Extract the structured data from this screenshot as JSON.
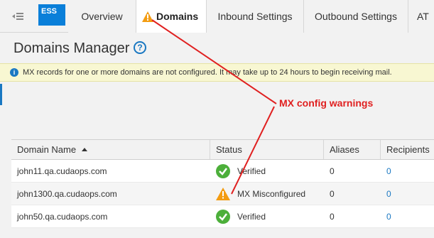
{
  "app": {
    "logo": "ESS"
  },
  "tabs": [
    {
      "label": "Overview",
      "active": false,
      "warning": false
    },
    {
      "label": "Domains",
      "active": true,
      "warning": true
    },
    {
      "label": "Inbound Settings",
      "active": false,
      "warning": false
    },
    {
      "label": "Outbound Settings",
      "active": false,
      "warning": false
    },
    {
      "label": "AT",
      "active": false,
      "warning": false
    }
  ],
  "page": {
    "title": "Domains Manager",
    "help": "?"
  },
  "banner": {
    "icon": "i",
    "text": "MX records for one or more domains are not configured. It may take up to 24 hours to begin receiving mail."
  },
  "annotation": {
    "text": "MX config warnings",
    "color": "#e02020"
  },
  "table": {
    "columns": [
      "Domain Name",
      "Status",
      "Aliases",
      "Recipients"
    ],
    "sort": {
      "column": "Domain Name",
      "direction": "ascending"
    },
    "rows": [
      {
        "domain": "john11.qa.cudaops.com",
        "status": "Verified",
        "status_icon": "check-icon",
        "aliases": "0",
        "recipients": "0"
      },
      {
        "domain": "john1300.qa.cudaops.com",
        "status": "MX Misconfigured",
        "status_icon": "warning-icon",
        "aliases": "0",
        "recipients": "0"
      },
      {
        "domain": "john50.qa.cudaops.com",
        "status": "Verified",
        "status_icon": "check-icon",
        "aliases": "0",
        "recipients": "0"
      }
    ]
  },
  "colors": {
    "accent": "#1a78c2",
    "logo_bg": "#0a7fd9",
    "verified": "#4caf3a",
    "warning": "#f39c12",
    "banner_bg": "#f8f7d2"
  }
}
